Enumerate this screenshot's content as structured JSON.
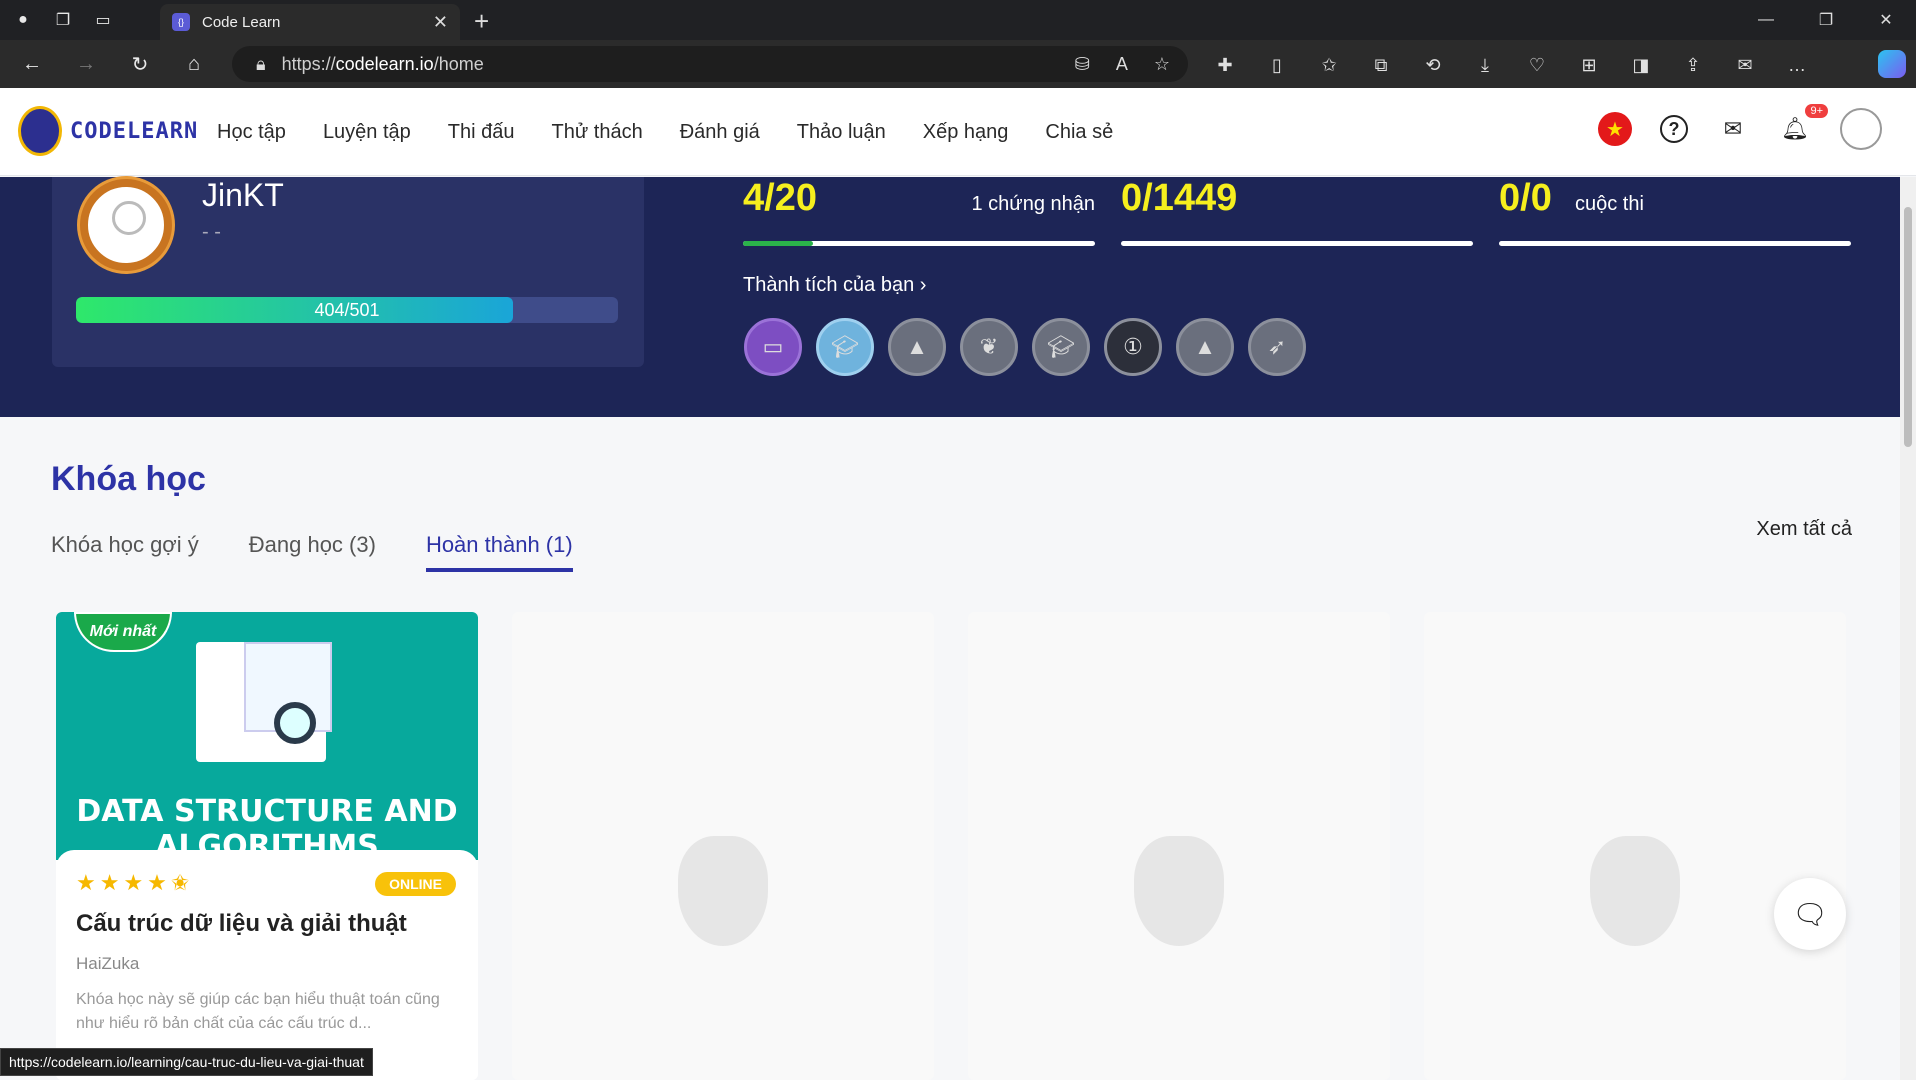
{
  "browser": {
    "tab_title": "Code Learn",
    "url_scheme": "https://",
    "url_host": "codelearn.io",
    "url_path": "/home",
    "status_url": "https://codelearn.io/learning/cau-truc-du-lieu-va-giai-thuat"
  },
  "site": {
    "logo_text": "CODELEARN",
    "nav": [
      "Học tập",
      "Luyện tập",
      "Thi đấu",
      "Thử thách",
      "Đánh giá",
      "Thảo luận",
      "Xếp hạng",
      "Chia sẻ"
    ],
    "notif_badge": "9+"
  },
  "profile": {
    "name": "JinKT",
    "subtitle": "- -",
    "xp_text": "404/501",
    "xp_fraction": 0.806
  },
  "stats": [
    {
      "value": "4/20",
      "label": "1 chứng nhận",
      "progress": 0.2
    },
    {
      "value": "0/1449",
      "label": "",
      "progress": 0
    },
    {
      "value": "0/0",
      "label": "cuộc thi",
      "progress": 0
    }
  ],
  "achievements": {
    "title": "Thành tích của bạn",
    "items": [
      "laptop-badge",
      "graduation-cap-badge",
      "mountain-badge",
      "laurel-badge",
      "cap-badge",
      "number-one-badge",
      "mountain-badge-2",
      "rocket-badge"
    ]
  },
  "courses": {
    "title": "Khóa học",
    "tabs": [
      "Khóa học gợi ý",
      "Đang học (3)",
      "Hoàn thành (1)"
    ],
    "active_tab": 2,
    "see_all": "Xem tất cả",
    "featured": {
      "ribbon": "Mới nhất",
      "cover_title": "DATA STRUCTURE AND ALGORITHMS",
      "rating_stars": 4.5,
      "mode": "ONLINE",
      "title": "Cấu trúc dữ liệu và giải thuật",
      "author": "HaiZuka",
      "description": "Khóa học này sẽ giúp các bạn hiểu thuật toán cũng như hiểu rõ bản chất của các cấu trúc d..."
    }
  },
  "colors": {
    "brand": "#2d33a6",
    "banner": "#1d2556",
    "stat_yellow": "#f6ef1e",
    "cover_teal": "#07a99c"
  }
}
